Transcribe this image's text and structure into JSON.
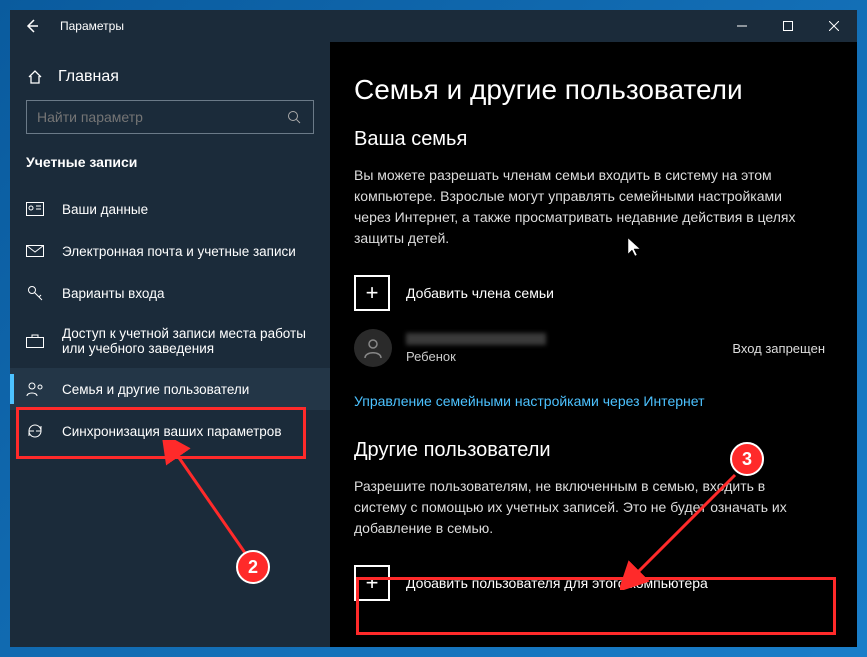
{
  "titlebar": {
    "title": "Параметры"
  },
  "sidebar": {
    "home": "Главная",
    "search_placeholder": "Найти параметр",
    "category": "Учетные записи",
    "items": [
      {
        "label": "Ваши данные"
      },
      {
        "label": "Электронная почта и учетные записи"
      },
      {
        "label": "Варианты входа"
      },
      {
        "label": "Доступ к учетной записи места работы или учебного заведения"
      },
      {
        "label": "Семья и другие пользователи"
      },
      {
        "label": "Синхронизация ваших параметров"
      }
    ]
  },
  "main": {
    "heading": "Семья и другие пользователи",
    "family_heading": "Ваша семья",
    "family_desc": "Вы можете разрешать членам семьи входить в систему на этом компьютере. Взрослые могут управлять семейными настройками через Интернет, а также просматривать недавние действия в целях защиты детей.",
    "add_family": "Добавить члена семьи",
    "member_role": "Ребенок",
    "member_status": "Вход запрещен",
    "manage_link": "Управление семейными настройками через Интернет",
    "other_heading": "Другие пользователи",
    "other_desc": "Разрешите пользователям, не включенным в семью, входить в систему с помощью их учетных записей. Это не будет означать их добавление в семью.",
    "add_other": "Добавить пользователя для этого компьютера"
  },
  "annotations": {
    "step2": "2",
    "step3": "3"
  }
}
